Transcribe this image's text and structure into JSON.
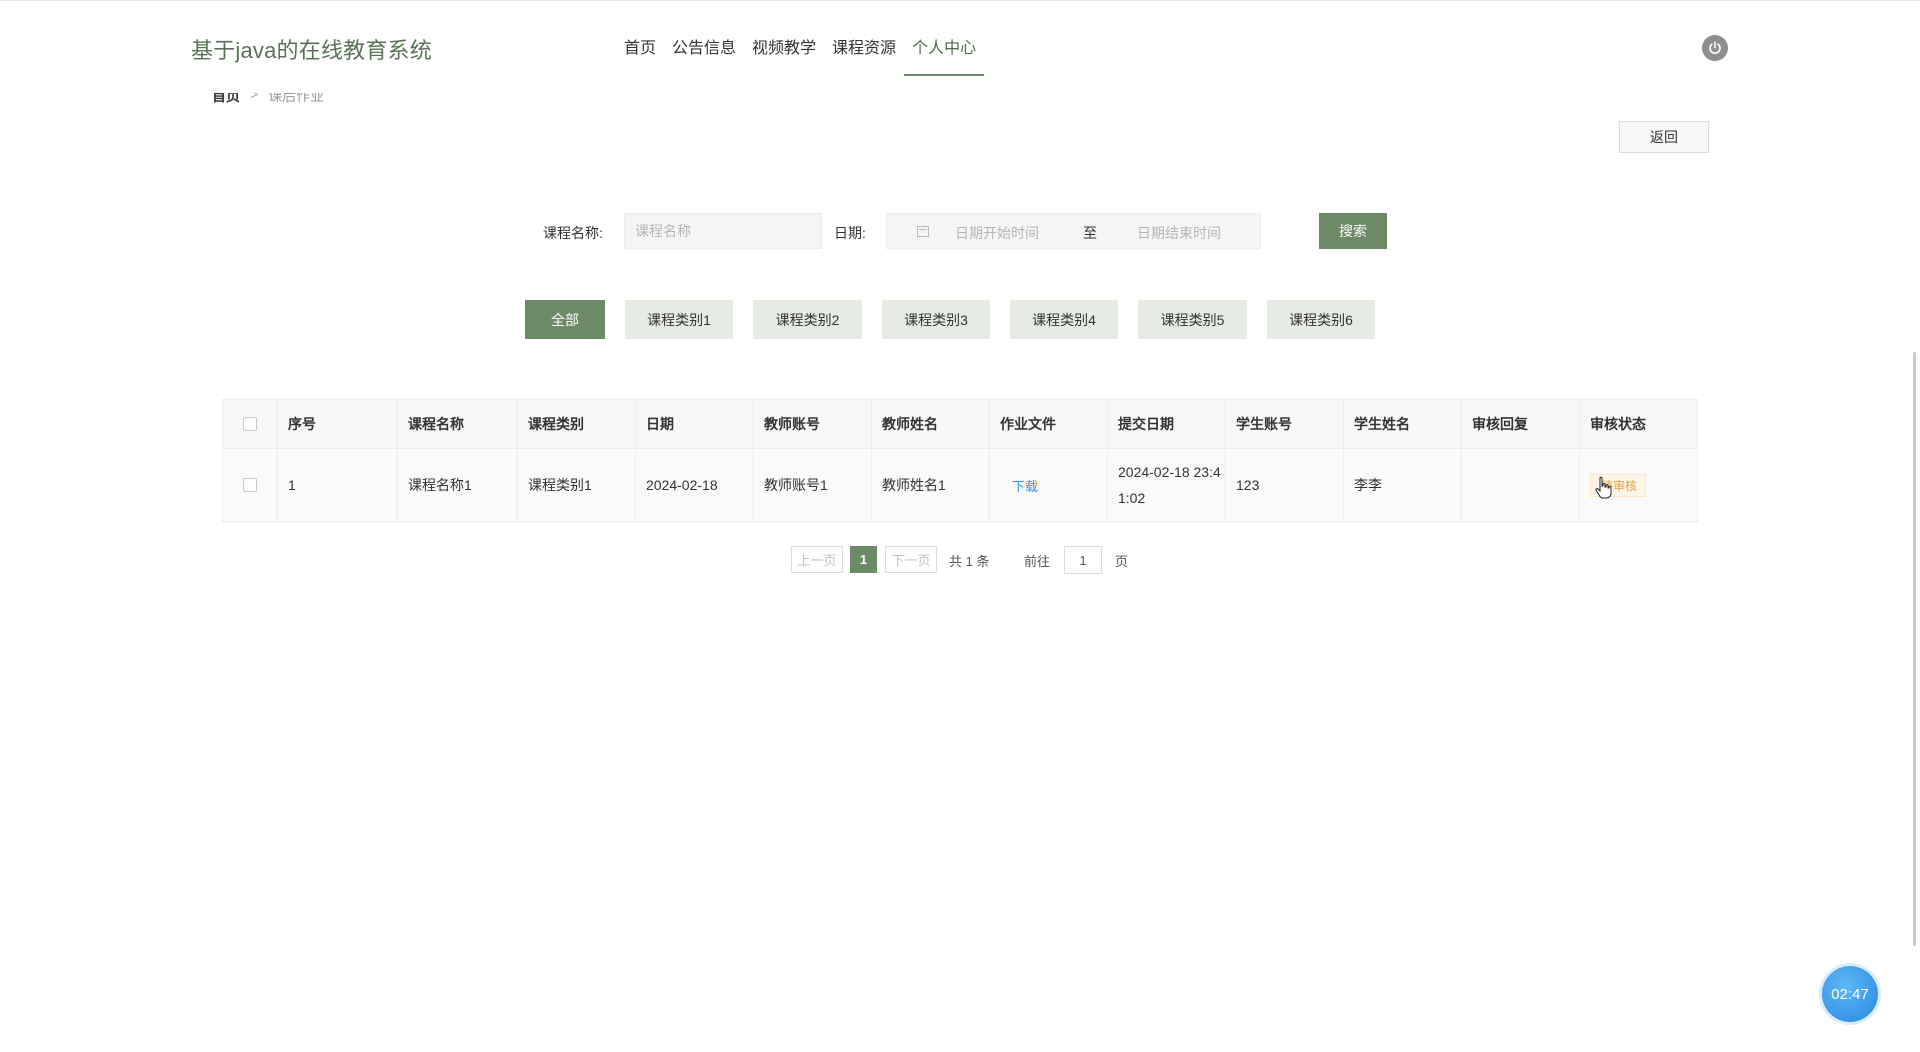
{
  "header": {
    "site_title": "基于java的在线教育系统",
    "nav": [
      "首页",
      "公告信息",
      "视频教学",
      "课程资源",
      "个人中心"
    ],
    "active_nav": "个人中心",
    "power_icon": "power-icon"
  },
  "breadcrumb": {
    "home": "首页",
    "separator": ">",
    "current": "课后作业"
  },
  "back_label": "返回",
  "search": {
    "course_label": "课程名称:",
    "course_placeholder": "课程名称",
    "date_label": "日期:",
    "date_start_placeholder": "日期开始时间",
    "date_to": "至",
    "date_end_placeholder": "日期结束时间",
    "search_label": "搜索"
  },
  "categories": [
    "全部",
    "课程类别1",
    "课程类别2",
    "课程类别3",
    "课程类别4",
    "课程类别5",
    "课程类别6"
  ],
  "active_category": "全部",
  "table": {
    "headers": [
      "序号",
      "课程名称",
      "课程类别",
      "日期",
      "教师账号",
      "教师姓名",
      "作业文件",
      "提交日期",
      "学生账号",
      "学生姓名",
      "审核回复",
      "审核状态"
    ],
    "rows": [
      {
        "index": "1",
        "course_name": "课程名称1",
        "course_type": "课程类别1",
        "date": "2024-02-18",
        "teacher_account": "教师账号1",
        "teacher_name": "教师姓名1",
        "homework_file": "下载",
        "submit_date": "2024-02-18 23:41:02",
        "student_account": "123",
        "student_name": "李李",
        "review_reply": "",
        "review_status": "待审核"
      }
    ]
  },
  "pagination": {
    "prev": "上一页",
    "current": "1",
    "next": "下一页",
    "total": "共 1 条",
    "goto": "前往",
    "goto_value": "1",
    "page_unit": "页"
  },
  "timer": "02:47",
  "colors": {
    "accent": "#6b8a65",
    "title": "#5b7158",
    "link": "#3a8ee6",
    "badge": "#e2a243",
    "timer": "#2a86e0"
  }
}
